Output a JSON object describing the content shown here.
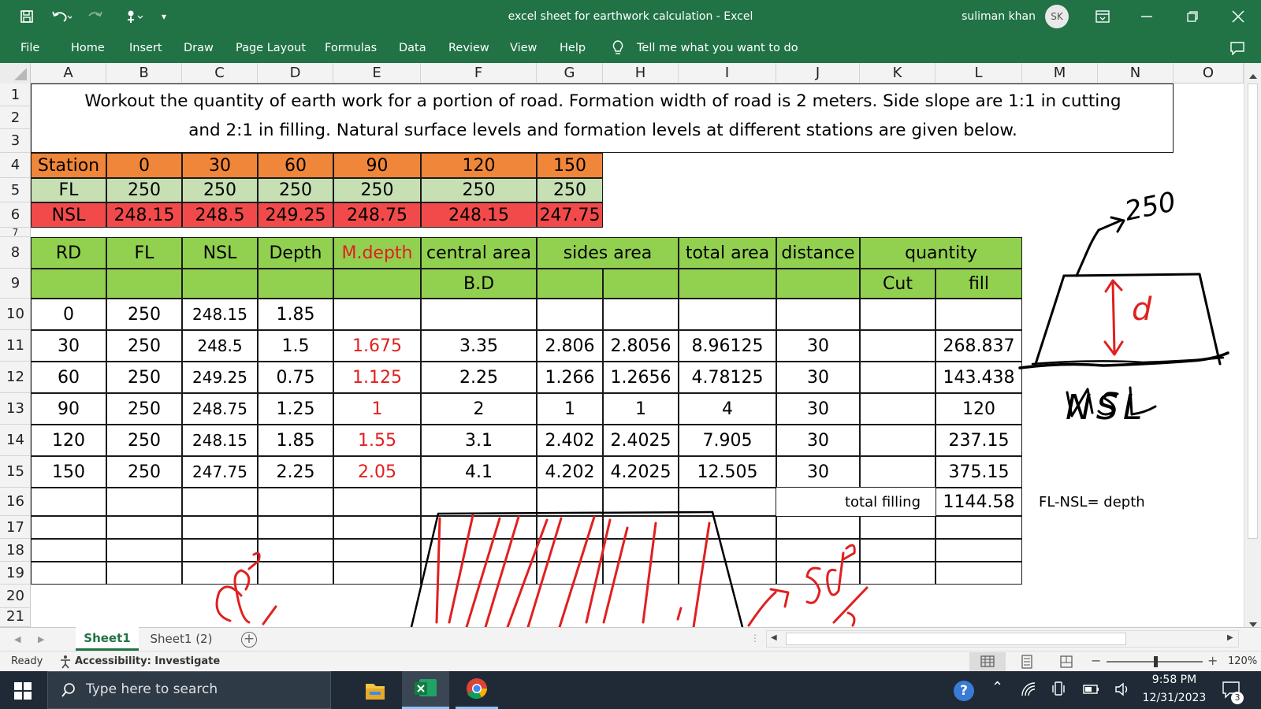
{
  "titlebar": {
    "title": "excel sheet for earthwork calculation  -  Excel",
    "user": "suliman khan",
    "avatar_initials": "SK",
    "bg_color": "#217346"
  },
  "menu": {
    "items": [
      "File",
      "Home",
      "Insert",
      "Draw",
      "Page Layout",
      "Formulas",
      "Data",
      "Review",
      "View",
      "Help"
    ],
    "tell_me": "Tell me what you want to do"
  },
  "grid": {
    "columns": [
      "A",
      "B",
      "C",
      "D",
      "E",
      "F",
      "G",
      "H",
      "I",
      "J",
      "K",
      "L",
      "M",
      "N",
      "O"
    ],
    "rows": [
      "1",
      "2",
      "3",
      "4",
      "5",
      "6",
      "7",
      "8",
      "9",
      "10",
      "11",
      "12",
      "13",
      "14",
      "15",
      "16",
      "17",
      "18",
      "19",
      "20",
      "21"
    ]
  },
  "problem_text": {
    "line1": "Workout the quantity of earth work for a portion of road. Formation width of road is 2 meters. Side slope are 1:1 in cutting",
    "line2": "and 2:1 in filling. Natural surface levels and formation levels at different stations are given below."
  },
  "given": {
    "station": [
      "Station",
      "0",
      "30",
      "60",
      "90",
      "120",
      "150"
    ],
    "fl": [
      "FL",
      "250",
      "250",
      "250",
      "250",
      "250",
      "250"
    ],
    "nsl": [
      "NSL",
      "248.15",
      "248.5",
      "249.25",
      "248.75",
      "248.15",
      "247.75"
    ],
    "colors": {
      "station": "#f0863a",
      "fl": "#c6e0b4",
      "nsl": "#f24a4a",
      "header_green": "#92d050",
      "red_text": "#e02020"
    }
  },
  "calc": {
    "headers": {
      "rd": "RD",
      "fl": "FL",
      "nsl": "NSL",
      "depth": "Depth",
      "mdepth": "M.depth",
      "central": "central area",
      "sides": "sides area",
      "total": "total area",
      "distance": "distance",
      "quantity": "quantity",
      "bd": "B.D",
      "cut": "Cut",
      "fill": "fill"
    },
    "rows": [
      {
        "rd": "0",
        "fl": "250",
        "nsl": "248.15",
        "depth": "1.85",
        "mdepth": "",
        "central": "",
        "side1": "",
        "side2": "",
        "total": "",
        "distance": "",
        "cut": "",
        "fill": ""
      },
      {
        "rd": "30",
        "fl": "250",
        "nsl": "248.5",
        "depth": "1.5",
        "mdepth": "1.675",
        "central": "3.35",
        "side1": "2.806",
        "side2": "2.8056",
        "total": "8.96125",
        "distance": "30",
        "cut": "",
        "fill": "268.837"
      },
      {
        "rd": "60",
        "fl": "250",
        "nsl": "249.25",
        "depth": "0.75",
        "mdepth": "1.125",
        "central": "2.25",
        "side1": "1.266",
        "side2": "1.2656",
        "total": "4.78125",
        "distance": "30",
        "cut": "",
        "fill": "143.438"
      },
      {
        "rd": "90",
        "fl": "250",
        "nsl": "248.75",
        "depth": "1.25",
        "mdepth": "1",
        "central": "2",
        "side1": "1",
        "side2": "1",
        "total": "4",
        "distance": "30",
        "cut": "",
        "fill": "120"
      },
      {
        "rd": "120",
        "fl": "250",
        "nsl": "248.15",
        "depth": "1.85",
        "mdepth": "1.55",
        "central": "3.1",
        "side1": "2.402",
        "side2": "2.4025",
        "total": "7.905",
        "distance": "30",
        "cut": "",
        "fill": "237.15"
      },
      {
        "rd": "150",
        "fl": "250",
        "nsl": "247.75",
        "depth": "2.25",
        "mdepth": "2.05",
        "central": "4.1",
        "side1": "4.202",
        "side2": "4.2025",
        "total": "12.505",
        "distance": "30",
        "cut": "",
        "fill": "375.15"
      }
    ],
    "total_filling_label": "total filling",
    "total_filling_value": "1144.58",
    "note": "FL-NSL= depth"
  },
  "sketch": {
    "fl_value": "250",
    "depth_label": "d",
    "nsl_label": "NSL"
  },
  "sheets": {
    "tabs": [
      "Sheet1",
      "Sheet1 (2)"
    ],
    "active": "Sheet1"
  },
  "status": {
    "ready": "Ready",
    "accessibility": "Accessibility: Investigate",
    "zoom": "120%"
  },
  "taskbar": {
    "search_placeholder": "Type here to search",
    "time": "9:58 PM",
    "date": "12/31/2023",
    "notifications": "3"
  }
}
